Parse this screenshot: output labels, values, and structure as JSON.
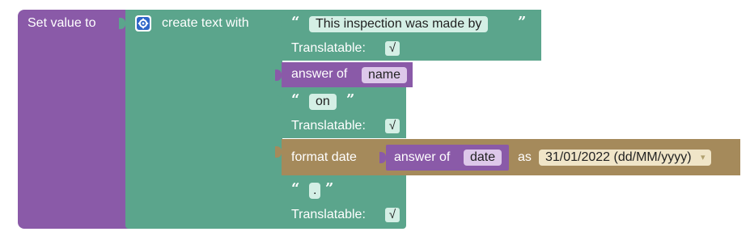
{
  "colors": {
    "set_block": "#8a5aa8",
    "text_block": "#5ba58c",
    "answer_block": "#8a5aa8",
    "format_block": "#a58a5b",
    "checkbox_fill": "#d4efe5",
    "field_fill_text": "#d4efe5",
    "field_fill_answer": "#ddc8ea",
    "field_fill_format": "#f0e5c8"
  },
  "set_block": {
    "label": "Set value to"
  },
  "create_text_block": {
    "icon": "gear-icon",
    "label": "create text with"
  },
  "items": {
    "text1": {
      "open_quote": "“",
      "value": "This inspection was made by",
      "close_quote": "”",
      "translatable_label": "Translatable:",
      "checked": "√"
    },
    "answer1": {
      "label": "answer of",
      "field": "name"
    },
    "text2": {
      "open_quote": "“",
      "value": "on",
      "close_quote": "”",
      "translatable_label": "Translatable:",
      "checked": "√"
    },
    "format_date": {
      "label": "format date",
      "answer_label": "answer of",
      "answer_field": "date",
      "as_label": "as",
      "format_value": "31/01/2022 (dd/MM/yyyy)",
      "dropdown_arrow": "▾"
    },
    "text3": {
      "open_quote": "“",
      "value": ".",
      "close_quote": "”",
      "translatable_label": "Translatable:",
      "checked": "√"
    }
  }
}
